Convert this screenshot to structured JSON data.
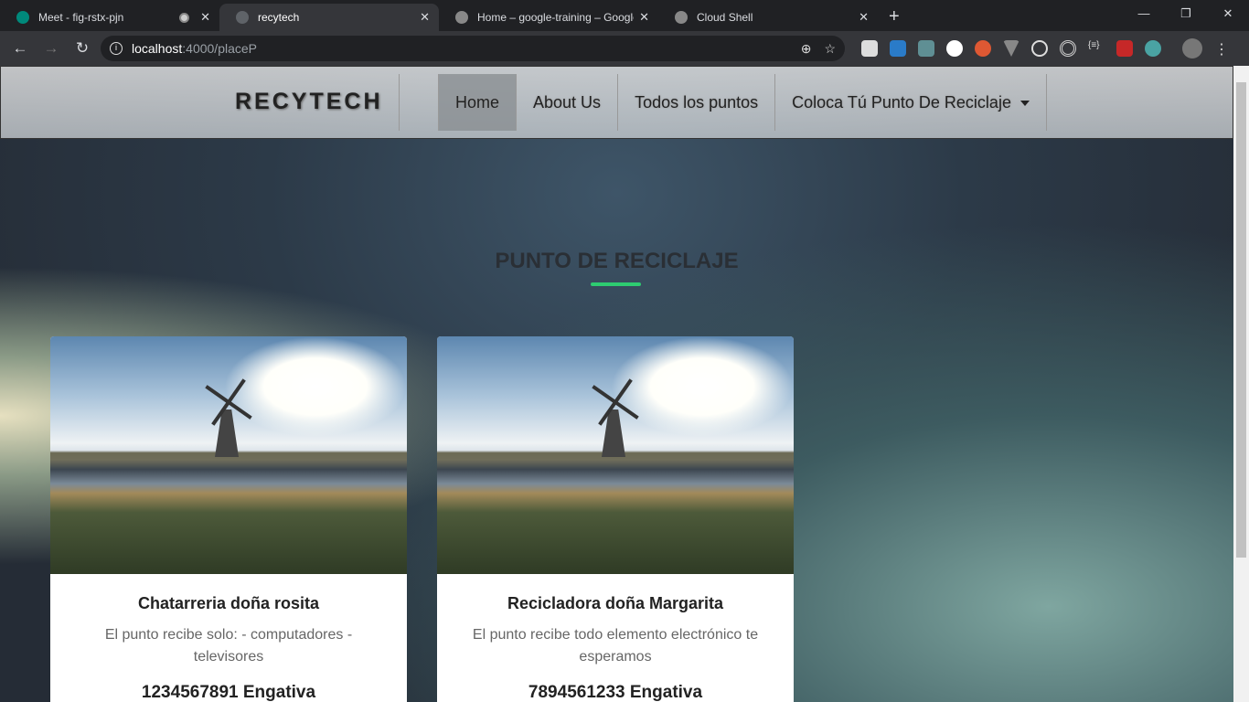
{
  "browser": {
    "tabs": [
      {
        "title": "Meet - fig-rstx-pjn",
        "favicon_color": "#00897b"
      },
      {
        "title": "recytech",
        "favicon_color": "#5f6368"
      },
      {
        "title": "Home – google-training – Google",
        "favicon_color": "#888"
      },
      {
        "title": "Cloud Shell",
        "favicon_color": "#888"
      }
    ],
    "url_host": "localhost",
    "url_path": ":4000/placeP",
    "extension_icons": [
      "cast-icon",
      "blue-extension-icon",
      "color-picker-icon",
      "h-icon",
      "duckduckgo-icon",
      "vue-devtools-icon",
      "react-devtools-icon",
      "target-icon",
      "json-icon",
      "red-ff-icon",
      "cloud-icon"
    ]
  },
  "navbar": {
    "brand": "RECYTECH",
    "links": [
      "Home",
      "About Us",
      "Todos los puntos",
      "Coloca Tú Punto De Reciclaje"
    ]
  },
  "section": {
    "title": "PUNTO DE RECICLAJE",
    "accent": "#2ecc71"
  },
  "cards": [
    {
      "name": "Chatarreria doña rosita",
      "description": "El punto recibe solo: - computadores - televisores",
      "phone_location": "1234567891 Engativa"
    },
    {
      "name": "Recicladora doña Margarita",
      "description": "El punto recibe todo elemento electrónico te esperamos",
      "phone_location": "7894561233 Engativa"
    }
  ]
}
